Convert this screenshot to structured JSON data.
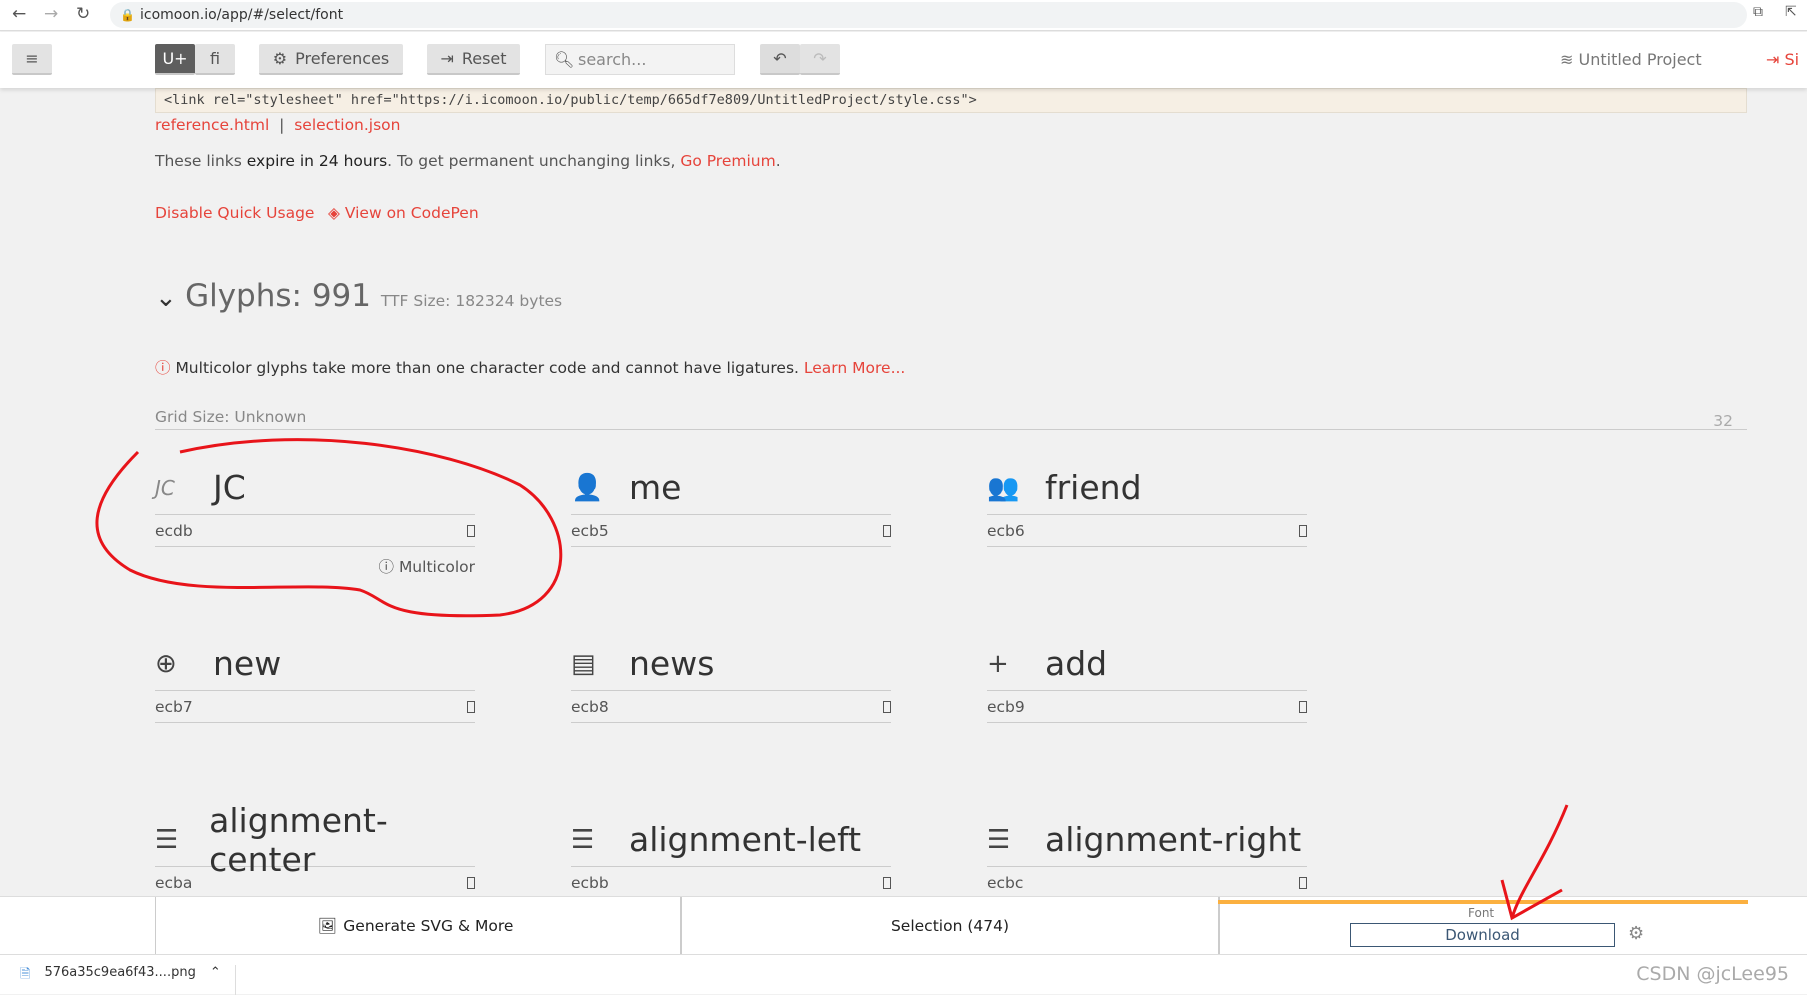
{
  "browser": {
    "url": "icomoon.io/app/#/select/font"
  },
  "toolbar": {
    "unicode_label": "U+",
    "ligature_label": "fi",
    "preferences": "Preferences",
    "reset": "Reset",
    "search_placeholder": "search...",
    "project": "Untitled Project",
    "signin": "Si"
  },
  "quick_usage": {
    "code": "<link rel=\"stylesheet\" href=\"https://i.icomoon.io/public/temp/665df7e809/UntitledProject/style.css\">",
    "reference": "reference.html",
    "sep": "|",
    "selection": "selection.json",
    "expire_pre": "These links ",
    "expire_bold": "expire in 24 hours",
    "expire_mid": ". To get permanent unchanging links, ",
    "premium": "Go Premium",
    "expire_end": ".",
    "disable": "Disable Quick Usage",
    "codepen": "View on CodePen"
  },
  "glyphs": {
    "title": "Glyphs: 991",
    "ttf": "TTF Size: 182324 bytes",
    "notice": "Multicolor glyphs take more than one character code and cannot have ligatures.",
    "learn": "Learn More...",
    "grid": "Grid Size: Unknown",
    "grid_num": "32",
    "multicolor": "Multicolor",
    "items": [
      {
        "name": "JC",
        "code": "ecdb",
        "icon": "jc-icon",
        "glyph": "JC"
      },
      {
        "name": "me",
        "code": "ecb5",
        "icon": "user-icon",
        "glyph": "👤"
      },
      {
        "name": "friend",
        "code": "ecb6",
        "icon": "users-icon",
        "glyph": "👥"
      },
      {
        "name": "new",
        "code": "ecb7",
        "icon": "plus-circle-icon",
        "glyph": "⊕"
      },
      {
        "name": "news",
        "code": "ecb8",
        "icon": "newspaper-icon",
        "glyph": "▤"
      },
      {
        "name": "add",
        "code": "ecb9",
        "icon": "plus-icon",
        "glyph": "+"
      },
      {
        "name": "alignment-center",
        "code": "ecba",
        "icon": "align-center-icon",
        "glyph": "☰"
      },
      {
        "name": "alignment-left",
        "code": "ecbb",
        "icon": "align-left-icon",
        "glyph": "☰"
      },
      {
        "name": "alignment-right",
        "code": "ecbc",
        "icon": "align-right-icon",
        "glyph": "☰"
      }
    ]
  },
  "bottom": {
    "generate": "Generate SVG & More",
    "selection": "Selection (474)",
    "font_label": "Font",
    "download": "Download"
  },
  "download_bar": {
    "file": "576a35c9ea6f43....png"
  },
  "watermark": "CSDN @jcLee95",
  "colors": {
    "accent": "#e6443b",
    "progress": "#fbb040",
    "annotation": "#e8141a"
  }
}
